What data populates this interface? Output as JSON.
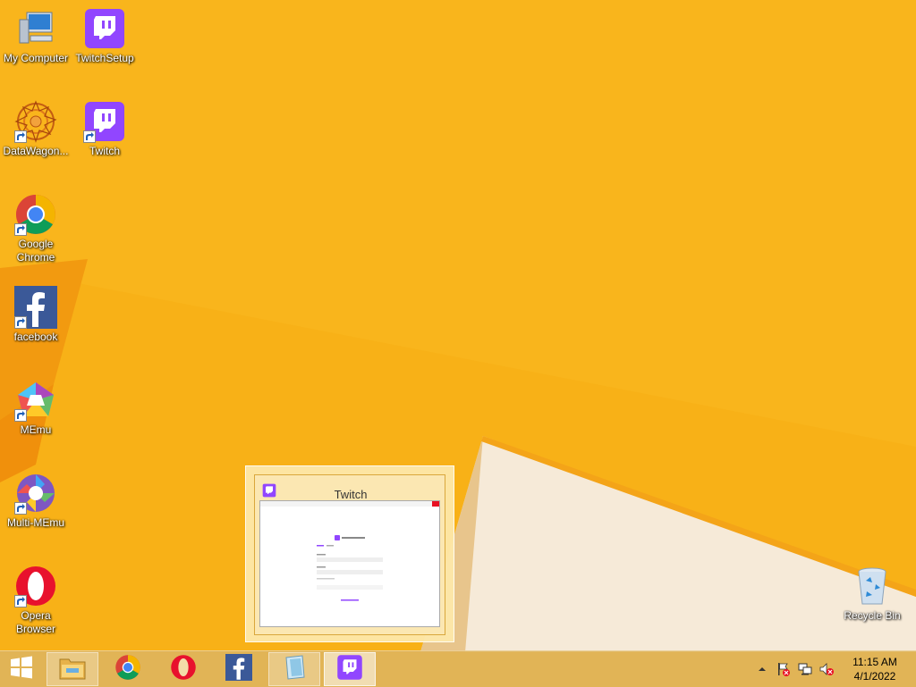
{
  "desktop": {
    "icons": [
      {
        "label": "My Computer",
        "icon": "computer-icon"
      },
      {
        "label": "TwitchSetup",
        "icon": "twitch-icon"
      },
      {
        "label": "DataWagon...",
        "icon": "datawagon-icon"
      },
      {
        "label": "Twitch",
        "icon": "twitch-icon"
      },
      {
        "label": "Google Chrome",
        "icon": "chrome-icon"
      },
      {
        "label": "facebook",
        "icon": "facebook-icon"
      },
      {
        "label": "MEmu",
        "icon": "memu-icon"
      },
      {
        "label": "Multi-MEmu",
        "icon": "multi-memu-icon"
      },
      {
        "label": "Opera Browser",
        "icon": "opera-icon"
      },
      {
        "label": "Recycle Bin",
        "icon": "recycle-bin-icon"
      }
    ]
  },
  "taskbar": {
    "apps": [
      {
        "name": "File Explorer",
        "icon": "file-explorer-icon"
      },
      {
        "name": "Google Chrome",
        "icon": "chrome-icon"
      },
      {
        "name": "Opera",
        "icon": "opera-icon"
      },
      {
        "name": "facebook",
        "icon": "facebook-icon"
      },
      {
        "name": "Notepad",
        "icon": "notepad-icon"
      },
      {
        "name": "Twitch",
        "icon": "twitch-icon"
      }
    ],
    "clock": {
      "time": "11:15 AM",
      "date": "4/1/2022"
    }
  },
  "thumbnail": {
    "title": "Twitch"
  },
  "colors": {
    "wallpaper": "#f7ad14",
    "twitch_purple": "#9146ff",
    "facebook_blue": "#3b5998",
    "opera_red": "#e8112d"
  }
}
